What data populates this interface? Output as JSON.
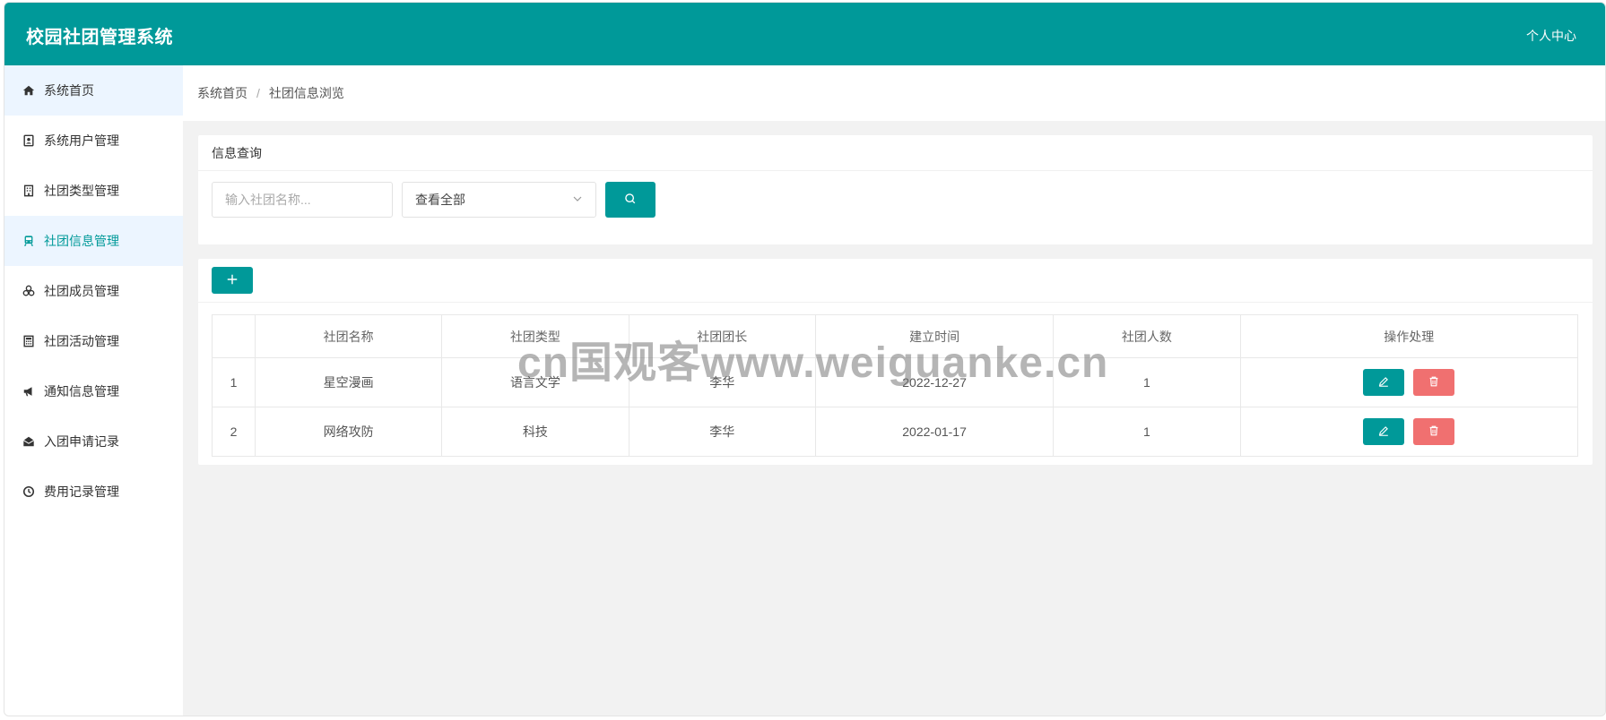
{
  "header": {
    "title": "校园社团管理系统",
    "user_menu": "个人中心"
  },
  "sidebar": {
    "items": [
      {
        "label": "系统首页",
        "icon": "home-icon"
      },
      {
        "label": "系统用户管理",
        "icon": "user-card-icon"
      },
      {
        "label": "社团类型管理",
        "icon": "building-icon"
      },
      {
        "label": "社团信息管理",
        "icon": "train-icon"
      },
      {
        "label": "社团成员管理",
        "icon": "cubes-icon"
      },
      {
        "label": "社团活动管理",
        "icon": "calculator-icon"
      },
      {
        "label": "通知信息管理",
        "icon": "bullhorn-icon"
      },
      {
        "label": "入团申请记录",
        "icon": "envelope-open-icon"
      },
      {
        "label": "费用记录管理",
        "icon": "clock-icon"
      }
    ]
  },
  "breadcrumb": {
    "home": "系统首页",
    "separator": "/",
    "current": "社团信息浏览"
  },
  "query": {
    "title": "信息查询",
    "name_placeholder": "输入社团名称...",
    "type_select_value": "查看全部"
  },
  "table": {
    "columns": [
      "",
      "社团名称",
      "社团类型",
      "社团团长",
      "建立时间",
      "社团人数",
      "操作处理"
    ],
    "rows": [
      {
        "idx": "1",
        "name": "星空漫画",
        "type": "语言文学",
        "leader": "李华",
        "date": "2022-12-27",
        "count": "1"
      },
      {
        "idx": "2",
        "name": "网络攻防",
        "type": "科技",
        "leader": "李华",
        "date": "2022-01-17",
        "count": "1"
      }
    ]
  },
  "watermark": "cn国观客www.weiguanke.cn",
  "colors": {
    "primary": "#009999",
    "danger": "#f07070",
    "active_bg": "#ecf5ff"
  }
}
